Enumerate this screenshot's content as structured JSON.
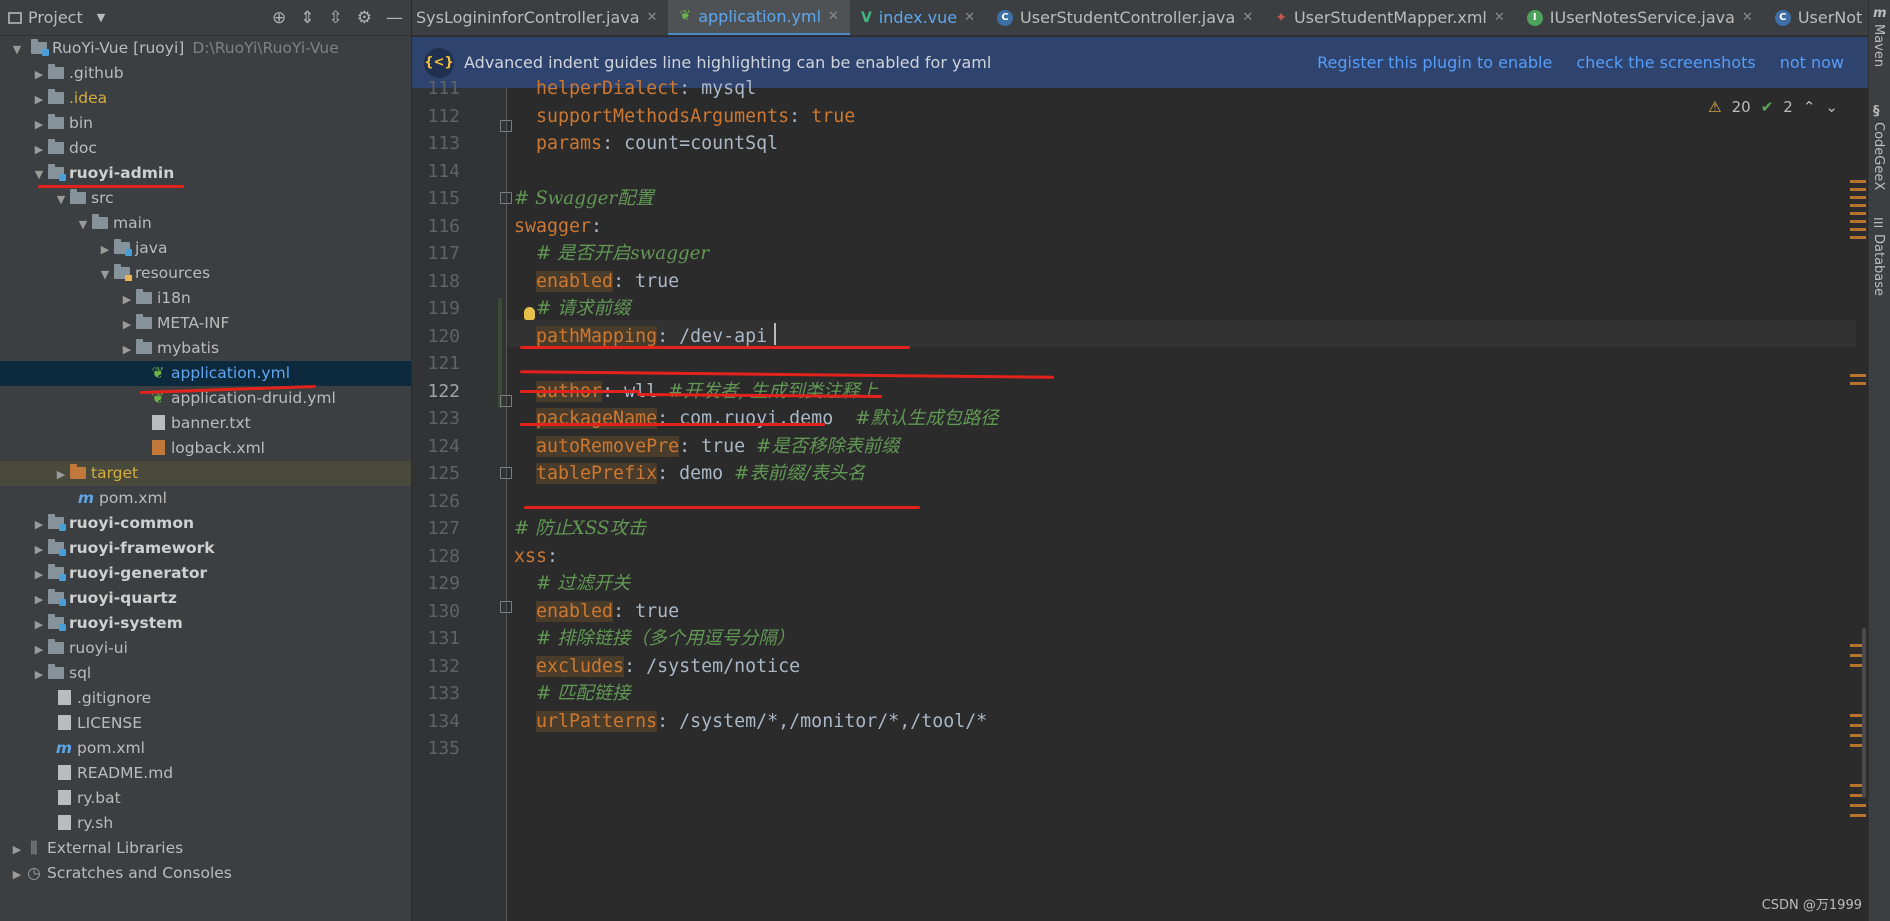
{
  "project_panel": {
    "title": "Project",
    "root": {
      "name": "RuoYi-Vue [ruoyi]",
      "path": "D:\\RuoYi\\RuoYi-Vue"
    },
    "items": [
      {
        "label": ".github"
      },
      {
        "label": ".idea"
      },
      {
        "label": "bin"
      },
      {
        "label": "doc"
      },
      {
        "label": "ruoyi-admin"
      },
      {
        "label": "src"
      },
      {
        "label": "main"
      },
      {
        "label": "java"
      },
      {
        "label": "resources"
      },
      {
        "label": "i18n"
      },
      {
        "label": "META-INF"
      },
      {
        "label": "mybatis"
      },
      {
        "label": "application.yml"
      },
      {
        "label": "application-druid.yml"
      },
      {
        "label": "banner.txt"
      },
      {
        "label": "logback.xml"
      },
      {
        "label": "target"
      },
      {
        "label": "pom.xml"
      },
      {
        "label": "ruoyi-common"
      },
      {
        "label": "ruoyi-framework"
      },
      {
        "label": "ruoyi-generator"
      },
      {
        "label": "ruoyi-quartz"
      },
      {
        "label": "ruoyi-system"
      },
      {
        "label": "ruoyi-ui"
      },
      {
        "label": "sql"
      },
      {
        "label": ".gitignore"
      },
      {
        "label": "LICENSE"
      },
      {
        "label": "pom.xml"
      },
      {
        "label": "README.md"
      },
      {
        "label": "ry.bat"
      },
      {
        "label": "ry.sh"
      },
      {
        "label": "External Libraries"
      },
      {
        "label": "Scratches and Consoles"
      }
    ]
  },
  "tabs": [
    {
      "label": "SysLogininforController.java"
    },
    {
      "label": "application.yml"
    },
    {
      "label": "index.vue"
    },
    {
      "label": "UserStudentController.java"
    },
    {
      "label": "UserStudentMapper.xml"
    },
    {
      "label": "IUserNotesService.java"
    },
    {
      "label": "UserNot"
    }
  ],
  "banner": {
    "message": "Advanced indent guides line highlighting can be enabled for yaml",
    "register": "Register this plugin to enable",
    "screenshots": "check the screenshots",
    "dismiss": "not now"
  },
  "inspections": {
    "warnings": "20",
    "weak": "2"
  },
  "editor": {
    "current_line": 122,
    "lines": [
      {
        "n": "111",
        "k": "helperDialect",
        "v": "mysql"
      },
      {
        "n": "112",
        "k": "supportMethodsArguments",
        "v": "true"
      },
      {
        "n": "113",
        "k": "params",
        "v": "count=countSql"
      },
      {
        "n": "114"
      },
      {
        "n": "115",
        "c": "# Swagger配置"
      },
      {
        "n": "116",
        "k": "swagger"
      },
      {
        "n": "117",
        "c": "# 是否开启swagger"
      },
      {
        "n": "118",
        "k": "enabled",
        "v": "true"
      },
      {
        "n": "119",
        "c": "# 请求前缀"
      },
      {
        "n": "120",
        "k": "pathMapping",
        "v": "/dev-api"
      },
      {
        "n": "121"
      },
      {
        "n": "122",
        "k": "author",
        "v": "wll",
        "c": "#开发者, 生成到类注释上"
      },
      {
        "n": "123",
        "k": "packageName",
        "v": "com.ruoyi.demo",
        "c": "#默认生成包路径"
      },
      {
        "n": "124",
        "k": "autoRemovePre",
        "v": "true",
        "c": "#是否移除表前缀"
      },
      {
        "n": "125",
        "k": "tablePrefix",
        "v": "demo",
        "c": "#表前缀/表头名"
      },
      {
        "n": "126"
      },
      {
        "n": "127",
        "c": "# 防止XSS攻击"
      },
      {
        "n": "128",
        "k": "xss"
      },
      {
        "n": "129",
        "c": "# 过滤开关"
      },
      {
        "n": "130",
        "k": "enabled",
        "v": "true"
      },
      {
        "n": "131",
        "c": "# 排除链接（多个用逗号分隔）"
      },
      {
        "n": "132",
        "k": "excludes",
        "v": "/system/notice"
      },
      {
        "n": "133",
        "c": "# 匹配链接"
      },
      {
        "n": "134",
        "k": "urlPatterns",
        "v": "/system/*,/monitor/*,/tool/*"
      },
      {
        "n": "135"
      }
    ]
  },
  "right_strip": [
    "Maven",
    "CodeGeeX",
    "Database"
  ],
  "watermark": "CSDN @万1999",
  "colors": {
    "annotation_red": "#e2221b",
    "accent_blue": "#4a88c7",
    "keyword": "#cc7832",
    "comment": "#629755"
  }
}
